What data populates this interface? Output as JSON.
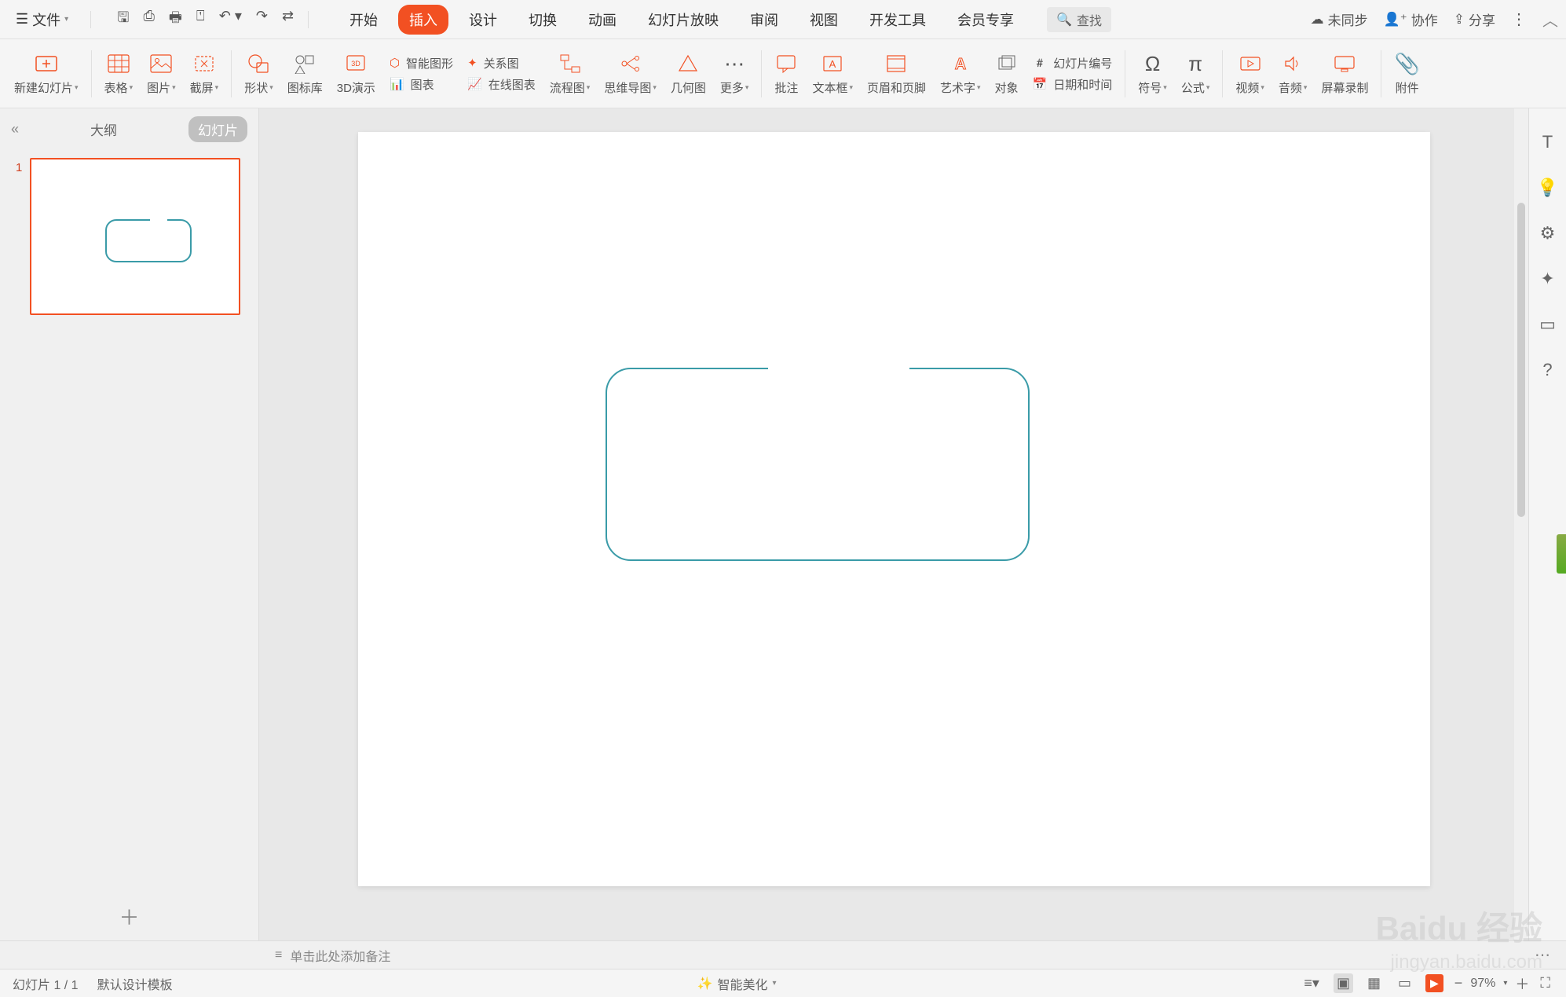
{
  "menubar": {
    "file": "文件",
    "tabs": [
      "开始",
      "插入",
      "设计",
      "切换",
      "动画",
      "幻灯片放映",
      "审阅",
      "视图",
      "开发工具",
      "会员专享"
    ],
    "active_tab_index": 1,
    "search": "查找",
    "unsync": "未同步",
    "collab": "协作",
    "share": "分享"
  },
  "ribbon": {
    "new_slide": "新建幻灯片",
    "table": "表格",
    "picture": "图片",
    "screenshot": "截屏",
    "shapes": "形状",
    "icon_lib": "图标库",
    "presentation_3d": "3D演示",
    "smart_graphic": "智能图形",
    "chart": "图表",
    "relation": "关系图",
    "online_chart": "在线图表",
    "flowchart": "流程图",
    "mindmap": "思维导图",
    "geometry": "几何图",
    "more": "更多",
    "annotation": "批注",
    "textbox": "文本框",
    "header_footer": "页眉和页脚",
    "wordart": "艺术字",
    "object": "对象",
    "slide_number": "幻灯片编号",
    "date_time": "日期和时间",
    "symbol": "符号",
    "formula": "公式",
    "video": "视频",
    "audio": "音频",
    "screen_record": "屏幕录制",
    "attachment": "附件"
  },
  "slide_panel": {
    "outline_tab": "大纲",
    "slides_tab": "幻灯片",
    "slides": [
      {
        "number": "1"
      }
    ]
  },
  "notes": {
    "placeholder": "单击此处添加备注"
  },
  "statusbar": {
    "slide_info": "幻灯片 1 / 1",
    "template": "默认设计模板",
    "beautify": "智能美化",
    "zoom": "97%"
  },
  "watermark": {
    "main": "Baidu 经验",
    "sub": "jingyan.baidu.com"
  }
}
